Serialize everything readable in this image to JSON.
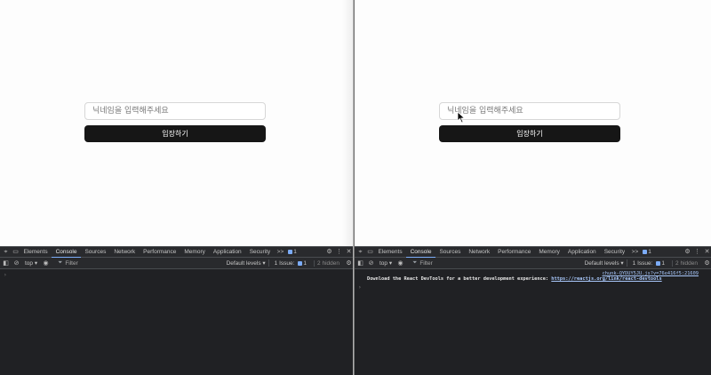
{
  "app": {
    "nickname_placeholder": "닉네임을 입력해주세요",
    "enter_button_label": "입장하기"
  },
  "devtools": {
    "tabs": [
      "Elements",
      "Console",
      "Sources",
      "Network",
      "Performance",
      "Memory",
      "Application",
      "Security"
    ],
    "active_tab": "Console",
    "more_tabs": ">>",
    "issues_badge_count": "1",
    "context": "top ▾",
    "filter_placeholder": "Filter",
    "levels": "Default levels ▾",
    "issues_label": "1 Issue:",
    "issues_count": "1",
    "hidden_label": "2 hidden",
    "prompt": "›"
  },
  "console_log": {
    "source": "chunk-QYDUY5JU.js?v=76e416f5:21609",
    "message": "Download the React DevTools for a better development experience: ",
    "link": "https://reactjs.org/link/react-devtools"
  },
  "colors": {
    "button_bg": "#161616",
    "devtools_bg": "#202124",
    "accent": "#7cacf8"
  }
}
